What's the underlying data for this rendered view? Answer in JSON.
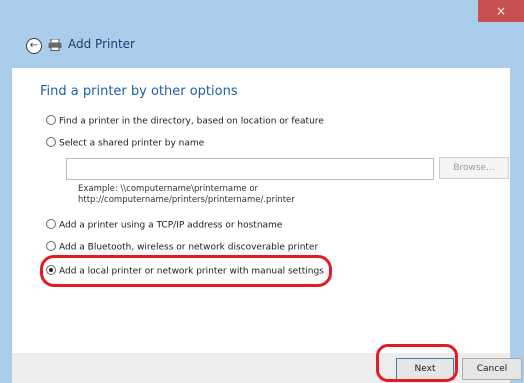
{
  "window": {
    "title": "Add Printer",
    "close_label": "×"
  },
  "icons": {
    "back": "back-arrow-icon",
    "printer": "printer-icon",
    "close": "close-icon"
  },
  "main": {
    "heading": "Find a printer by other options",
    "options": [
      {
        "label": "Find a printer in the directory, based on location or feature",
        "selected": false
      },
      {
        "label": "Select a shared printer by name",
        "selected": false
      },
      {
        "label": "Add a printer using a TCP/IP address or hostname",
        "selected": false
      },
      {
        "label": "Add a Bluetooth, wireless or network discoverable printer",
        "selected": false
      },
      {
        "label": "Add a local printer or network printer with manual settings",
        "selected": true
      }
    ],
    "shared_input_value": "",
    "browse_label": "Browse...",
    "example_text": "Example: \\\\computername\\printername or\nhttp://computername/printers/printername/.printer"
  },
  "footer": {
    "next_label": "Next",
    "cancel_label": "Cancel"
  },
  "colors": {
    "frame": "#a9cdea",
    "heading": "#1f5fa5",
    "annotation": "#e31b23",
    "close": "#c75050"
  }
}
